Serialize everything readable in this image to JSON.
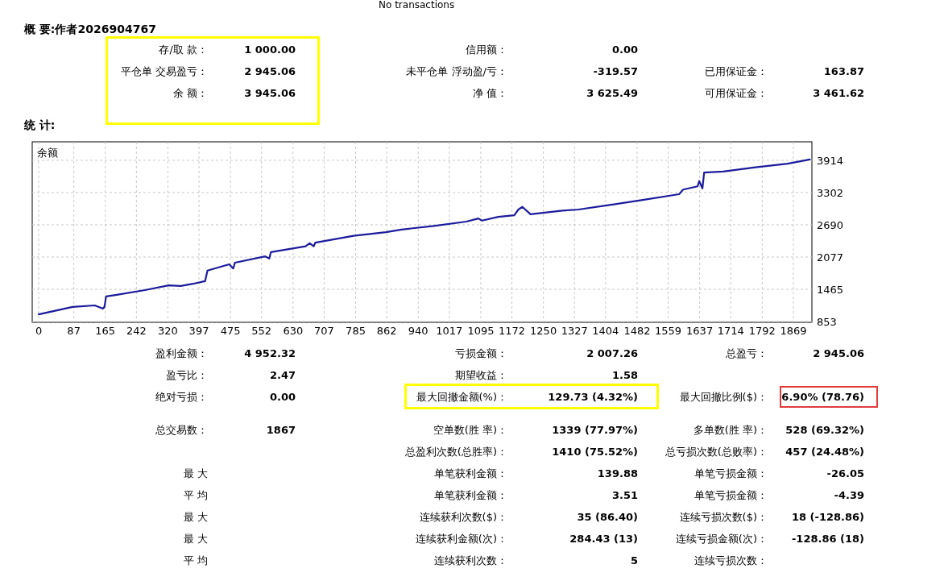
{
  "note": "No transactions",
  "summary": {
    "title": "概 要:作者2026904767",
    "frame": {
      "kind": "group",
      "color": "#ffff00"
    },
    "rows": [
      [
        {
          "kind": "field",
          "label": "存/取 款：",
          "value": "1 000.00"
        },
        {
          "kind": "field",
          "label": "信用额：",
          "value": "0.00"
        },
        {
          "kind": "blank"
        }
      ],
      [
        {
          "kind": "field",
          "label": "平仓单 交易盈亏：",
          "value": "2 945.06"
        },
        {
          "kind": "field",
          "label": "未平仓单 浮动盈/亏：",
          "value": "-319.57"
        },
        {
          "kind": "field",
          "label": "已用保证金：",
          "value": "163.87"
        }
      ],
      [
        {
          "kind": "field",
          "label": "余 额：",
          "value": "3 945.06"
        },
        {
          "kind": "field",
          "label": "净 值：",
          "value": "3 625.49"
        },
        {
          "kind": "field",
          "label": "可用保证金：",
          "value": "3 461.62"
        }
      ]
    ]
  },
  "stats_title": "统 计:",
  "chart_data": {
    "type": "line",
    "title": "余额",
    "grid": true,
    "xlim": [
      -16,
      1915
    ],
    "ylim": [
      838,
      4265
    ],
    "xticks": [
      0,
      87,
      165,
      242,
      320,
      397,
      475,
      552,
      630,
      707,
      785,
      862,
      940,
      1017,
      1095,
      1172,
      1250,
      1327,
      1404,
      1482,
      1559,
      1637,
      1714,
      1792,
      1869
    ],
    "yticks": [
      853,
      1465,
      2077,
      2690,
      3302,
      3914
    ],
    "x": [
      0,
      84,
      139,
      159,
      163,
      167,
      193,
      263,
      322,
      352,
      382,
      412,
      418,
      472,
      482,
      486,
      561,
      571,
      575,
      661,
      671,
      681,
      685,
      780,
      860,
      899,
      979,
      1059,
      1089,
      1098,
      1138,
      1178,
      1188,
      1198,
      1218,
      1297,
      1337,
      1417,
      1496,
      1586,
      1596,
      1632,
      1636,
      1644,
      1648,
      1695,
      1775,
      1855,
      1910
    ],
    "series": [
      {
        "color": "#1c1c9c",
        "values": [
          990,
          1130,
          1160,
          1100,
          1130,
          1330,
          1360,
          1450,
          1540,
          1530,
          1570,
          1620,
          1820,
          1940,
          1860,
          1970,
          2090,
          2050,
          2170,
          2280,
          2340,
          2280,
          2350,
          2480,
          2550,
          2600,
          2670,
          2750,
          2810,
          2770,
          2840,
          2870,
          2980,
          3030,
          2890,
          2960,
          2980,
          3070,
          3160,
          3270,
          3360,
          3420,
          3520,
          3380,
          3680,
          3700,
          3780,
          3850,
          3930
        ]
      }
    ]
  },
  "stats_groups": [
    [
      [
        {
          "kind": "field",
          "label": "盈利金额：",
          "value": "4 952.32"
        },
        {
          "kind": "field",
          "label": "亏损金额：",
          "value": "2 007.26"
        },
        {
          "kind": "field",
          "label": "总盈亏：",
          "value": "2 945.06"
        }
      ],
      [
        {
          "kind": "field",
          "label": "盈亏比：",
          "value": "2.47"
        },
        {
          "kind": "field",
          "label": "期望收益：",
          "value": "1.58"
        },
        {
          "kind": "blank"
        }
      ],
      [
        {
          "kind": "field",
          "label": "绝对亏损：",
          "value": "0.00"
        },
        {
          "kind": "field",
          "label": "最大回撤金额(%)：",
          "value": "129.73 (4.32%)",
          "frame": {
            "kind": "pair",
            "color": "#ffff00"
          }
        },
        {
          "kind": "field",
          "label": "最大回撤比例($)：",
          "value": "6.90% (78.76)",
          "frame": {
            "kind": "value",
            "color": "#e03c3c"
          }
        }
      ]
    ],
    [
      [
        {
          "kind": "field",
          "label": "总交易数：",
          "value": "1867"
        },
        {
          "kind": "field",
          "label": "空单数(胜 率)：",
          "value": "1339 (77.97%)"
        },
        {
          "kind": "field",
          "label": "多单数(胜 率)：",
          "value": "528 (69.32%)"
        }
      ],
      [
        {
          "kind": "blank"
        },
        {
          "kind": "field",
          "label": "总盈利次数(总胜率)：",
          "value": "1410 (75.52%)"
        },
        {
          "kind": "field",
          "label": "总亏损次数(总败率)：",
          "value": "457 (24.48%)"
        }
      ],
      [
        {
          "kind": "field",
          "label": "最 大"
        },
        {
          "kind": "field",
          "label": "单笔获利金额：",
          "value": "139.88"
        },
        {
          "kind": "field",
          "label": "单笔亏损金额：",
          "value": "-26.05"
        }
      ],
      [
        {
          "kind": "field",
          "label": "平 均"
        },
        {
          "kind": "field",
          "label": "单笔获利金额：",
          "value": "3.51"
        },
        {
          "kind": "field",
          "label": "单笔亏损金额：",
          "value": "-4.39"
        }
      ],
      [
        {
          "kind": "field",
          "label": "最 大"
        },
        {
          "kind": "field",
          "label": "连续获利次数($)：",
          "value": "35 (86.40)"
        },
        {
          "kind": "field",
          "label": "连续亏损次数($)：",
          "value": "18 (-128.86)"
        }
      ],
      [
        {
          "kind": "field",
          "label": "最 大"
        },
        {
          "kind": "field",
          "label": "连续获利金额(次)：",
          "value": "284.43 (13)"
        },
        {
          "kind": "field",
          "label": "连续亏损金额(次)：",
          "value": "-128.86 (18)"
        }
      ],
      [
        {
          "kind": "field",
          "label": "平 均"
        },
        {
          "kind": "field",
          "label": "连续获利次数：",
          "value": "5"
        },
        {
          "kind": "field",
          "label": "连续亏损次数："
        }
      ]
    ]
  ]
}
